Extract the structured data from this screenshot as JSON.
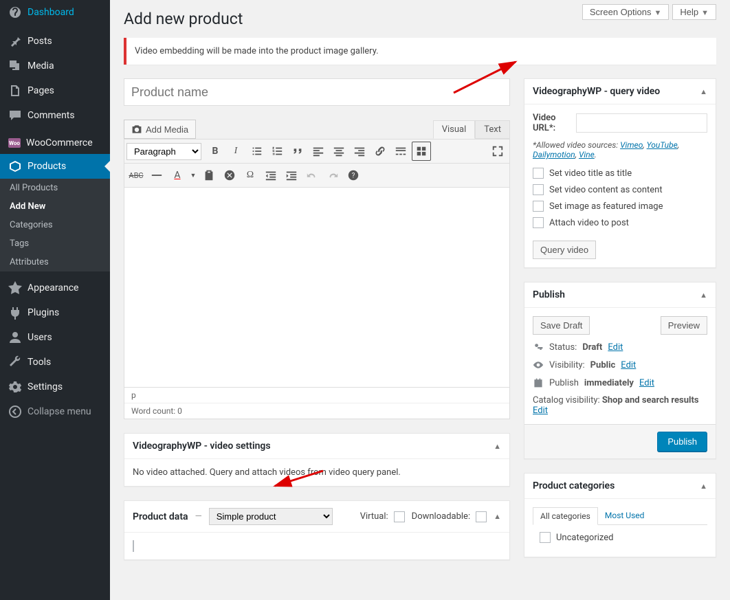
{
  "top": {
    "screen_options": "Screen Options",
    "help": "Help"
  },
  "page": {
    "title": "Add new product"
  },
  "notice": {
    "message": "Video embedding will be made into the product image gallery."
  },
  "title_field": {
    "placeholder": "Product name"
  },
  "editor": {
    "add_media": "Add Media",
    "tabs": {
      "visual": "Visual",
      "text": "Text"
    },
    "paragraph_label": "Paragraph",
    "path": "p",
    "word_count": "Word count: 0"
  },
  "metabox_video_settings": {
    "title": "VideographyWP - video settings",
    "body": "No video attached. Query and attach videos from video query panel."
  },
  "product_data": {
    "title": "Product data",
    "type": "Simple product",
    "virtual_label": "Virtual:",
    "downloadable_label": "Downloadable:"
  },
  "metabox_query_video": {
    "title": "VideographyWP - query video",
    "url_label": "Video URL*:",
    "hint_prefix": "*Allowed video sources: ",
    "sources": [
      "Vimeo",
      "YouTube",
      "Dailymotion",
      "Vine"
    ],
    "cb1": "Set video title as title",
    "cb2": "Set video content as content",
    "cb3": "Set image as featured image",
    "cb4": "Attach video to post",
    "button": "Query video"
  },
  "publish": {
    "title": "Publish",
    "save_draft": "Save Draft",
    "preview": "Preview",
    "status_label": "Status:",
    "status_value": "Draft",
    "visibility_label": "Visibility:",
    "visibility_value": "Public",
    "schedule_label": "Publish",
    "schedule_value": "immediately",
    "catalog_label": "Catalog visibility:",
    "catalog_value": "Shop and search results",
    "edit": "Edit",
    "publish_btn": "Publish"
  },
  "categories": {
    "title": "Product categories",
    "tab_all": "All categories",
    "tab_most": "Most Used",
    "item1": "Uncategorized"
  },
  "sidebar": {
    "dashboard": "Dashboard",
    "posts": "Posts",
    "media": "Media",
    "pages": "Pages",
    "comments": "Comments",
    "woocommerce": "WooCommerce",
    "products": "Products",
    "appearance": "Appearance",
    "plugins": "Plugins",
    "users": "Users",
    "tools": "Tools",
    "settings": "Settings",
    "collapse": "Collapse menu",
    "sub": {
      "all": "All Products",
      "add": "Add New",
      "categories": "Categories",
      "tags": "Tags",
      "attributes": "Attributes"
    }
  }
}
